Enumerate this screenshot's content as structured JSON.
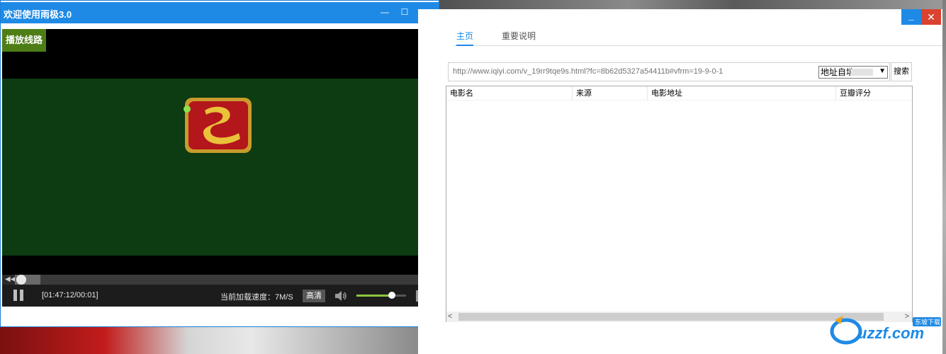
{
  "player": {
    "title": "欢迎使用雨极3.0",
    "route_button": "播放线路",
    "time": "[01:47:12/00:01]",
    "speed": "当前加载速度：7M/S",
    "quality": "高清",
    "progress_fraction": 0.03,
    "volume_fraction": 0.72
  },
  "search": {
    "tabs": [
      {
        "label": "主页",
        "active": true
      },
      {
        "label": "重要说明",
        "active": false
      }
    ],
    "url_placeholder": "http://www.iqiyi.com/v_19rr9tqe9s.html?fc=8b62d5327a54411b#vfrm=19-9-0-1",
    "source_select": "地址自填",
    "search_button": "搜索",
    "columns": [
      "电影名",
      "来源",
      "电影地址",
      "豆瓣评分"
    ]
  },
  "watermark": {
    "brand": "uzzf.com",
    "tag": "东坡下载"
  },
  "colors": {
    "titlebar": "#1e8ae6",
    "route_button": "#4e7d16",
    "video_green": "#0d3b12",
    "close": "#d9432f"
  }
}
